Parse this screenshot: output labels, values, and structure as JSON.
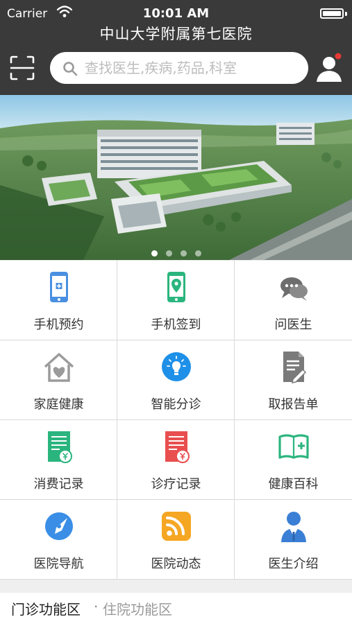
{
  "status_bar": {
    "carrier": "Carrier",
    "time": "10:01 AM"
  },
  "header": {
    "title": "中山大学附属第七医院"
  },
  "search": {
    "placeholder": "查找医生,疾病,药品,科室"
  },
  "banner": {
    "slide_count": 4,
    "active_index": 0
  },
  "grid": [
    {
      "label": "手机预约",
      "icon": "phone-appointment-icon",
      "color": "#4a90e2"
    },
    {
      "label": "手机签到",
      "icon": "phone-checkin-icon",
      "color": "#2bb57e"
    },
    {
      "label": "问医生",
      "icon": "chat-bubbles-icon",
      "color": "#6d6d6d"
    },
    {
      "label": "家庭健康",
      "icon": "family-home-icon",
      "color": "#9b9b9b"
    },
    {
      "label": "智能分诊",
      "icon": "lightbulb-icon",
      "color": "#1e90e8"
    },
    {
      "label": "取报告单",
      "icon": "report-document-icon",
      "color": "#7a7a7a"
    },
    {
      "label": "消费记录",
      "icon": "expense-record-icon",
      "color": "#2bb57e"
    },
    {
      "label": "诊疗记录",
      "icon": "treatment-record-icon",
      "color": "#e94f4f"
    },
    {
      "label": "健康百科",
      "icon": "health-book-icon",
      "color": "#2bb57e"
    },
    {
      "label": "医院导航",
      "icon": "compass-navigation-icon",
      "color": "#3a8ee6"
    },
    {
      "label": "医院动态",
      "icon": "rss-news-icon",
      "color": "#f5a623"
    },
    {
      "label": "医生介绍",
      "icon": "doctor-profile-icon",
      "color": "#3a7fd5"
    }
  ],
  "tabs": {
    "active": "门诊功能区",
    "separator": "·",
    "inactive": "住院功能区"
  }
}
